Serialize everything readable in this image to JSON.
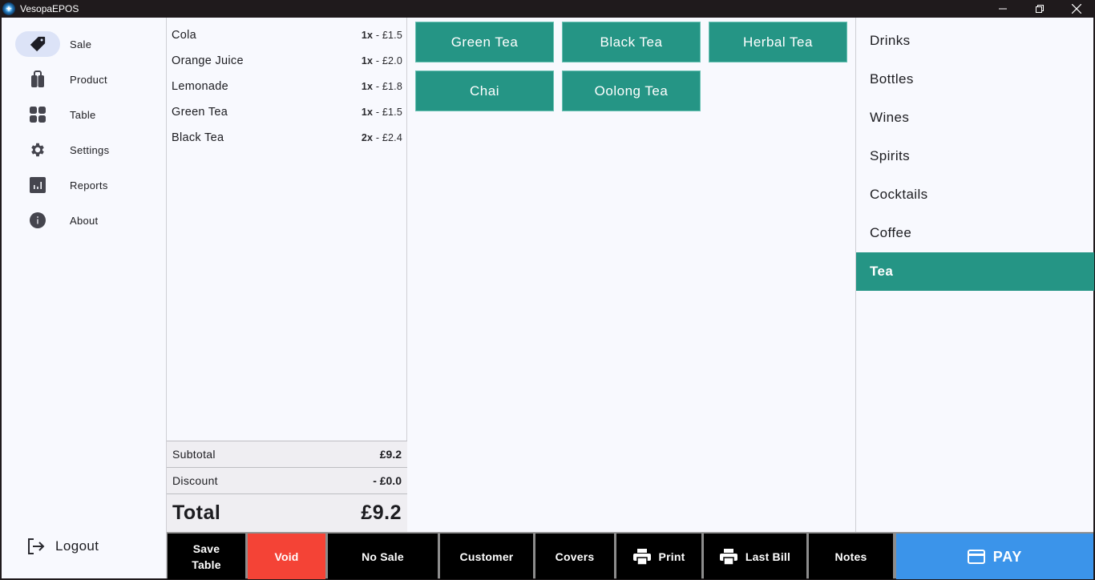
{
  "window": {
    "title": "VesopaEPOS",
    "controls": {
      "minimize": "—",
      "maximize": "❐",
      "close": "✕"
    }
  },
  "nav": {
    "items": [
      {
        "label": "Sale",
        "icon": "tag-icon",
        "active": true
      },
      {
        "label": "Product",
        "icon": "shopping-bag-icon",
        "active": false
      },
      {
        "label": "Table",
        "icon": "grid-icon",
        "active": false
      },
      {
        "label": "Settings",
        "icon": "gear-icon",
        "active": false
      },
      {
        "label": "Reports",
        "icon": "bar-chart-icon",
        "active": false
      },
      {
        "label": "About",
        "icon": "info-icon",
        "active": false
      }
    ],
    "logout_label": "Logout"
  },
  "order": {
    "items": [
      {
        "name": "Cola",
        "qty": "1x",
        "price": "£1.5"
      },
      {
        "name": "Orange Juice",
        "qty": "1x",
        "price": "£2.0"
      },
      {
        "name": "Lemonade",
        "qty": "1x",
        "price": "£1.8"
      },
      {
        "name": "Green Tea",
        "qty": "1x",
        "price": "£1.5"
      },
      {
        "name": "Black Tea",
        "qty": "2x",
        "price": "£2.4"
      }
    ],
    "separator": " - ",
    "subtotal_label": "Subtotal",
    "subtotal_value": "£9.2",
    "discount_label": "Discount",
    "discount_value": "- £0.0",
    "total_label": "Total",
    "total_value": "£9.2"
  },
  "products": {
    "items": [
      "Green Tea",
      "Black Tea",
      "Herbal Tea",
      "Chai",
      "Oolong Tea"
    ]
  },
  "categories": {
    "items": [
      "Drinks",
      "Bottles",
      "Wines",
      "Spirits",
      "Cocktails",
      "Coffee",
      "Tea"
    ],
    "selected": "Tea"
  },
  "actions": {
    "save_table": [
      "Save",
      "Table"
    ],
    "void": "Void",
    "no_sale": "No Sale",
    "customer": "Customer",
    "covers": "Covers",
    "print": "Print",
    "last_bill": "Last Bill",
    "notes": "Notes",
    "pay": "PAY"
  },
  "colors": {
    "accent_teal": "#259585",
    "void_red": "#f44336",
    "pay_blue": "#3b94ea",
    "nav_active_bg": "#dce3f7"
  }
}
